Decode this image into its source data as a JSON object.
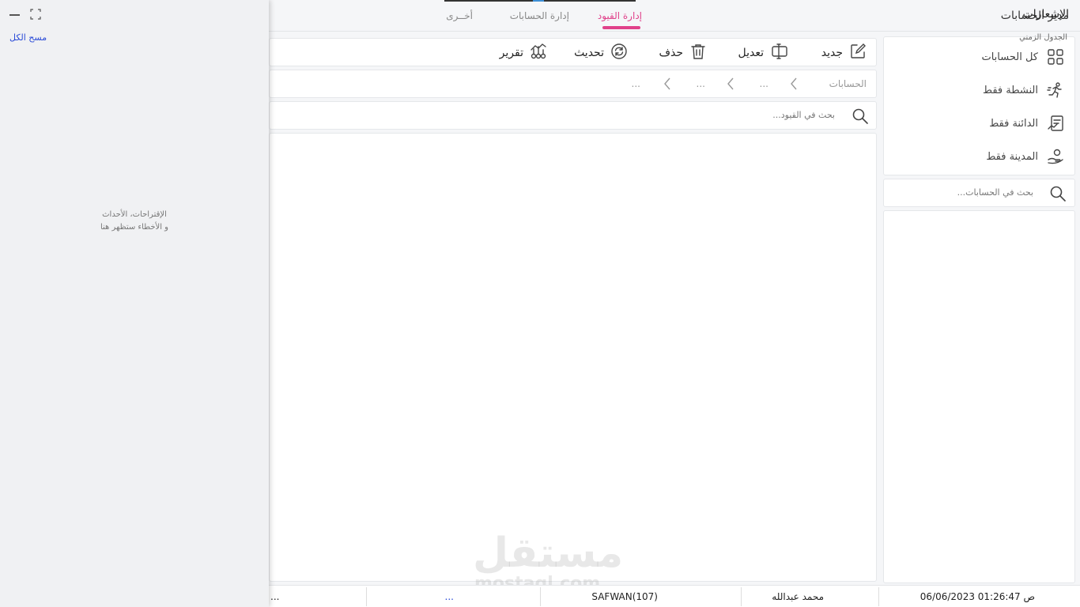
{
  "app": {
    "title": "مدير الحسابات"
  },
  "tabs": [
    {
      "label": "إدارة القيود",
      "active": true
    },
    {
      "label": "إدارة الحسابات",
      "active": false
    },
    {
      "label": "أخــرى",
      "active": false
    }
  ],
  "sidebar": {
    "filters": [
      {
        "label": "كل الحسابات",
        "icon": "grid-icon"
      },
      {
        "label": "النشطة فقط",
        "icon": "running-person-icon"
      },
      {
        "label": "الدائنة فقط",
        "icon": "credit-icon"
      },
      {
        "label": "المدينة فقط",
        "icon": "hand-coins-icon"
      }
    ],
    "search_placeholder": "بحث في الحسابات..."
  },
  "toolbar": {
    "new_label": "جديد",
    "edit_label": "تعديل",
    "delete_label": "حذف",
    "refresh_label": "تحديث",
    "report_label": "تقرير"
  },
  "breadcrumb": {
    "root": "الحسابات",
    "items": [
      "...",
      "...",
      "..."
    ]
  },
  "entries": {
    "search_placeholder": "بحث في القيود..."
  },
  "statusbar": {
    "datetime": "06/06/2023 01:26:47 ص",
    "user": "محمد عبدالله",
    "code": "SAFWAN(107)",
    "link": "...",
    "extra": "..."
  },
  "watermark": {
    "arabic": "مستقل",
    "latin": "mostaql.com"
  },
  "notifications": {
    "title": "الإشعارات",
    "timeline_label": "الجدول الزمني",
    "clear_all_label": "مسح الكل",
    "empty_line1": "الإقتراحات، الأحداث",
    "empty_line2": "و الأخطاء ستظهر هنا"
  },
  "colors": {
    "accent": "#e0418a",
    "link": "#2a4bd7",
    "panel_bg": "#f0f1f3"
  }
}
